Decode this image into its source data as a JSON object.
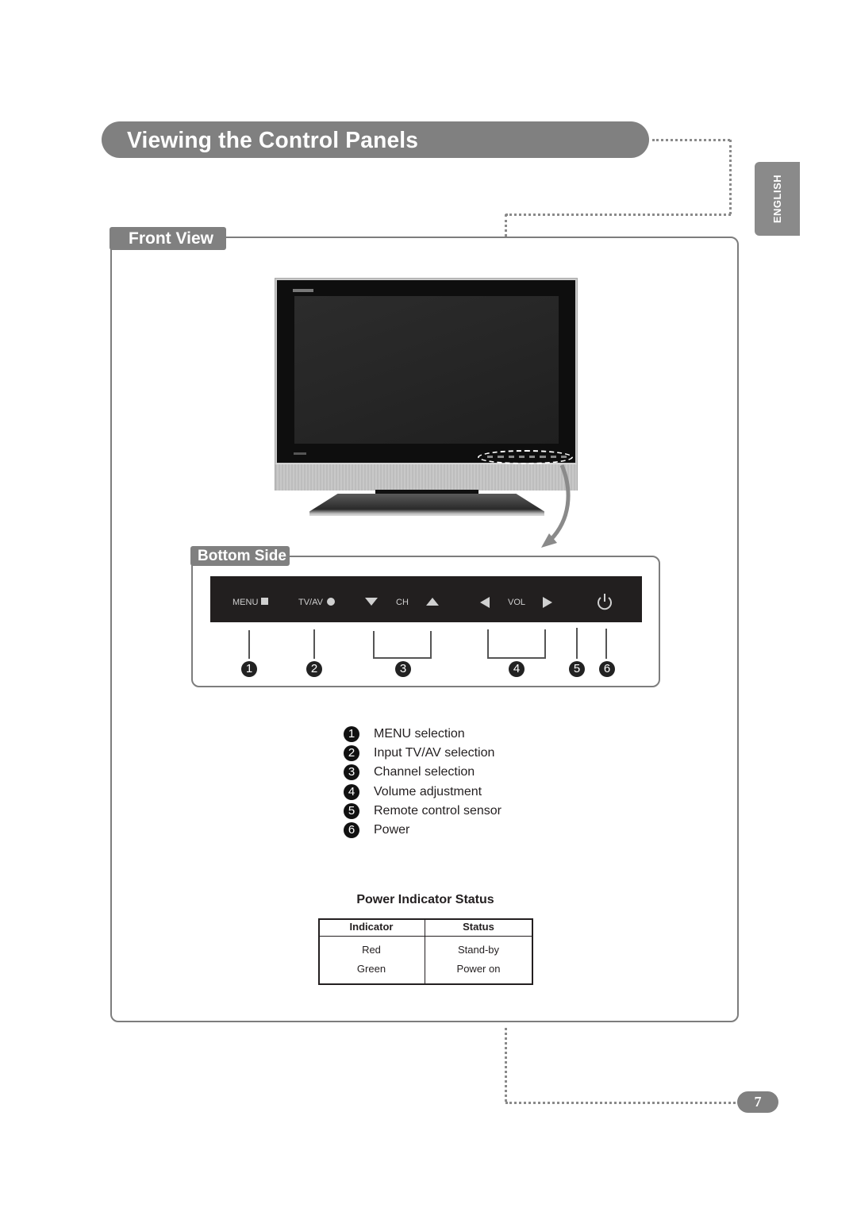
{
  "header": {
    "title": "Viewing the Control Panels",
    "language_tab": "ENGLISH"
  },
  "front_view": {
    "label": "Front View"
  },
  "bottom_side": {
    "label": "Bottom Side",
    "panel": {
      "menu": "MENU",
      "tvav": "TV/AV",
      "ch": "CH",
      "vol": "VOL"
    },
    "callouts": [
      "1",
      "2",
      "3",
      "4",
      "5",
      "6"
    ]
  },
  "legend": [
    {
      "num": "1",
      "label": "MENU selection"
    },
    {
      "num": "2",
      "label": "Input TV/AV selection"
    },
    {
      "num": "3",
      "label": "Channel selection"
    },
    {
      "num": "4",
      "label": "Volume adjustment"
    },
    {
      "num": "5",
      "label": "Remote control sensor"
    },
    {
      "num": "6",
      "label": "Power"
    }
  ],
  "power_table": {
    "title": "Power Indicator Status",
    "headers": [
      "Indicator",
      "Status"
    ],
    "rows": [
      [
        "Red",
        "Stand-by"
      ],
      [
        "Green",
        "Power on"
      ]
    ]
  },
  "page_number": "7",
  "colors": {
    "accent_gray": "#808080",
    "panel_dark": "#221f1f"
  }
}
